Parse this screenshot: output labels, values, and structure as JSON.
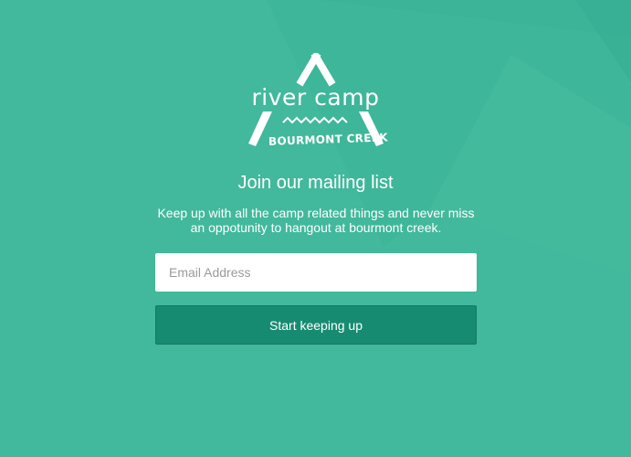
{
  "colors": {
    "background": "#42b89c",
    "button": "#178b72",
    "text": "#ffffff"
  },
  "logo": {
    "title": "river camp",
    "subtitle": "BOURMONT CREEK"
  },
  "signup": {
    "heading": "Join our mailing list",
    "description": "Keep up with all the camp related things and never miss an oppotunity to hangout at bourmont creek.",
    "email_placeholder": "Email Address",
    "email_value": "",
    "button_label": "Start keeping up"
  }
}
